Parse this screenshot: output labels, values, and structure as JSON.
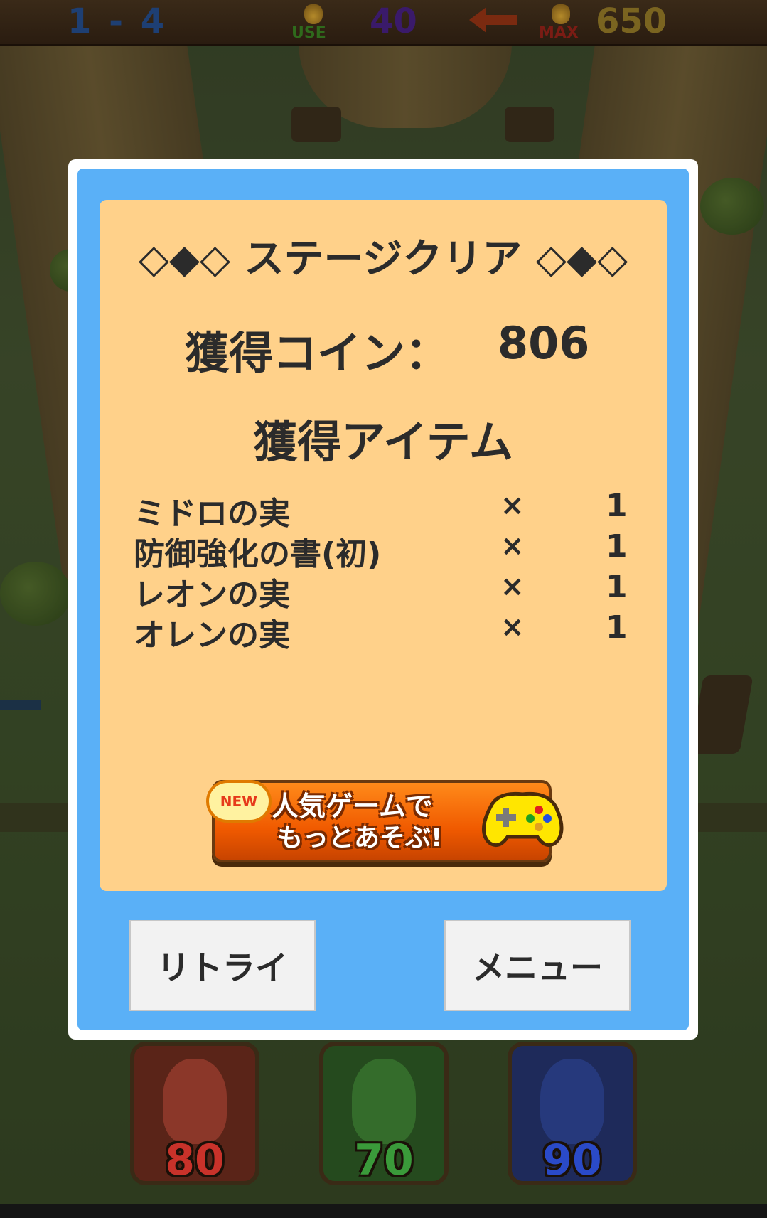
{
  "hud": {
    "stage": "1 - 4",
    "use_label": "USE",
    "use_value": "40",
    "max_label": "MAX",
    "max_value": "650"
  },
  "dialog": {
    "title": "◇◆◇ ステージクリア ◇◆◇",
    "coin_label": "獲得コイン：",
    "coin_value": "806",
    "items_title": "獲得アイテム",
    "items": [
      {
        "name": "ミドロの実",
        "x": "×",
        "count": "1"
      },
      {
        "name": "防御強化の書(初)",
        "x": "×",
        "count": "1"
      },
      {
        "name": "レオンの実",
        "x": "×",
        "count": "1"
      },
      {
        "name": "オレンの実",
        "x": "×",
        "count": "1"
      }
    ],
    "promo": {
      "new_badge": "NEW",
      "line1": "人気ゲームで",
      "line2": "もっとあそぶ!"
    },
    "buttons": {
      "retry": "リトライ",
      "menu": "メニュー"
    }
  },
  "cards": [
    {
      "value": "80",
      "color": "#c8322a"
    },
    {
      "value": "70",
      "color": "#3a9a3a"
    },
    {
      "value": "90",
      "color": "#2a4ac8"
    }
  ],
  "colors": {
    "dialog_blue": "#5ab0f7",
    "panel_cream": "#ffd18a",
    "promo_orange": "#f05a00"
  }
}
